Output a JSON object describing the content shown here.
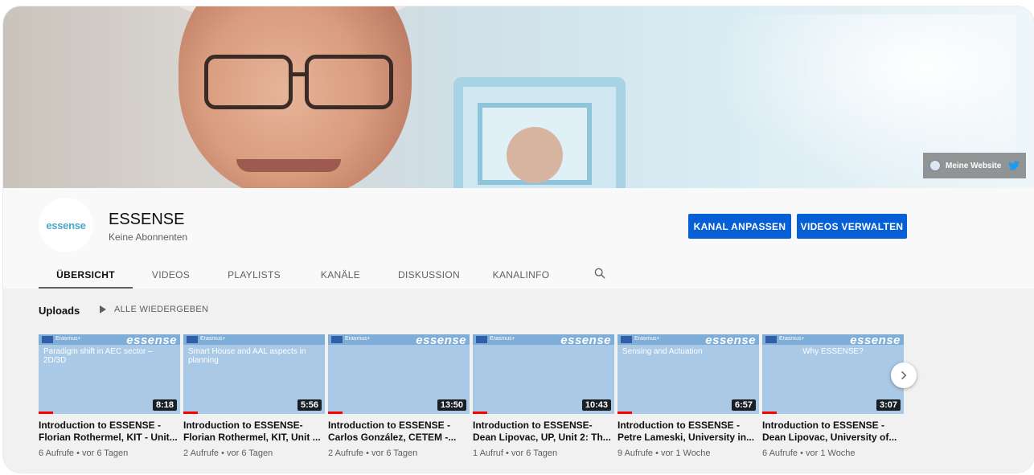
{
  "banner": {
    "links": {
      "website_label": "Meine Website"
    }
  },
  "channel": {
    "avatar_logo": "essense",
    "avatar_logo_small": "",
    "name": "ESSENSE",
    "subscribers": "Keine Abonnenten",
    "customize_label": "KANAL ANPASSEN",
    "manage_label": "VIDEOS VERWALTEN"
  },
  "tabs": [
    {
      "label": "ÜBERSICHT",
      "active": true
    },
    {
      "label": "VIDEOS"
    },
    {
      "label": "PLAYLISTS"
    },
    {
      "label": "KANÄLE"
    },
    {
      "label": "DISKUSSION"
    },
    {
      "label": "KANALINFO"
    }
  ],
  "uploads": {
    "title": "Uploads",
    "play_all": "ALLE WIEDERGEBEN"
  },
  "videos": [
    {
      "thumb_brand": "essense",
      "thumb_heading": "Paradigm shift in AEC sector – 2D/3D",
      "duration": "8:18",
      "title": "Introduction to ESSENSE - Florian Rothermel, KIT - Unit...",
      "meta": "6 Aufrufe • vor 6 Tagen"
    },
    {
      "thumb_brand": "",
      "thumb_heading": "Smart House and AAL aspects in planning",
      "duration": "5:56",
      "title": "Introduction to ESSENSE- Florian Rothermel, KIT, Unit ...",
      "meta": "2 Aufrufe • vor 6 Tagen"
    },
    {
      "thumb_brand": "essense",
      "thumb_heading": "",
      "duration": "13:50",
      "title": "Introduction to ESSENSE - Carlos González, CETEM -...",
      "meta": "2 Aufrufe • vor 6 Tagen"
    },
    {
      "thumb_brand": "essense",
      "thumb_heading": "",
      "duration": "10:43",
      "title": "Introduction to ESSENSE- Dean Lipovac, UP, Unit 2: Th...",
      "meta": "1 Aufruf • vor 6 Tagen"
    },
    {
      "thumb_brand": "essense",
      "thumb_heading": "Sensing and Actuation",
      "duration": "6:57",
      "title": "Introduction to ESSENSE - Petre Lameski, University in...",
      "meta": "9 Aufrufe • vor 1 Woche"
    },
    {
      "thumb_brand": "essense",
      "thumb_heading": "Why ESSENSE?",
      "duration": "3:07",
      "title": "Introduction to ESSENSE - Dean Lipovac, University of...",
      "meta": "6 Aufrufe • vor 1 Woche"
    }
  ],
  "thumb_eu_label": "Erasmus+",
  "colors": {
    "accent": "#065fd4",
    "thumb_bg": "#a9c9e6",
    "progress": "#ff0000"
  }
}
